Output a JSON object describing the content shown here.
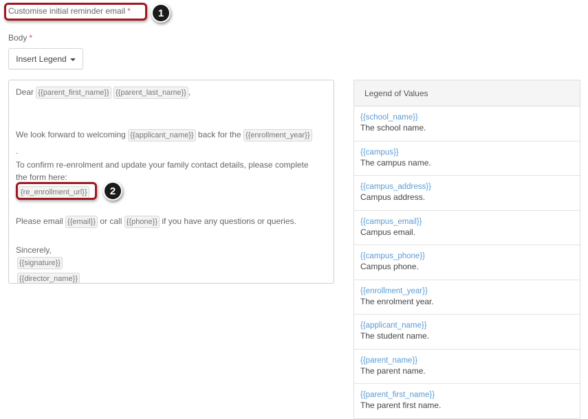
{
  "heading": {
    "label": "Customise initial reminder email",
    "required_mark": "*"
  },
  "badges": {
    "one": "1",
    "two": "2"
  },
  "body_field": {
    "label": "Body",
    "required_mark": "*"
  },
  "insert_legend": {
    "label": "Insert Legend"
  },
  "editor": {
    "greeting": "Dear",
    "greeting_tags": [
      "{{parent_first_name}}",
      "{{parent_last_name}}"
    ],
    "greeting_end": ",",
    "welcome_pre": "We look forward to welcoming",
    "welcome_tag": "{{applicant_name}}",
    "welcome_mid": "back for the",
    "welcome_tag2": "{{enrollment_year}}",
    "period": ".",
    "confirm_line1": "To confirm re-enrolment and update your family contact details, please complete",
    "confirm_line2": "the form here:",
    "url_tag": "{re_enrollment_url}}",
    "contact_pre": "Please email",
    "contact_tag1": "{{email}}",
    "contact_mid": "or call",
    "contact_tag2": "{{phone}}",
    "contact_post": "if you have any questions or queries.",
    "sign_off": "Sincerely,",
    "signature_tag": "{{signature}}",
    "director_tag": "{{director_name}}"
  },
  "legend": {
    "title": "Legend of Values",
    "items": [
      {
        "key": "{{school_name}}",
        "desc": "The school name."
      },
      {
        "key": "{{campus}}",
        "desc": "The campus name."
      },
      {
        "key": "{{campus_address}}",
        "desc": "Campus address."
      },
      {
        "key": "{{campus_email}}",
        "desc": "Campus email."
      },
      {
        "key": "{{campus_phone}}",
        "desc": "Campus phone."
      },
      {
        "key": "{{enrollment_year}}",
        "desc": "The enrolment year."
      },
      {
        "key": "{{applicant_name}}",
        "desc": "The student name."
      },
      {
        "key": "{{parent_name}}",
        "desc": "The parent name."
      },
      {
        "key": "{{parent_first_name}}",
        "desc": "The parent first name."
      }
    ]
  },
  "colors": {
    "highlight": "#a0171f",
    "required": "#d9534f",
    "link": "#5b9bd5"
  }
}
